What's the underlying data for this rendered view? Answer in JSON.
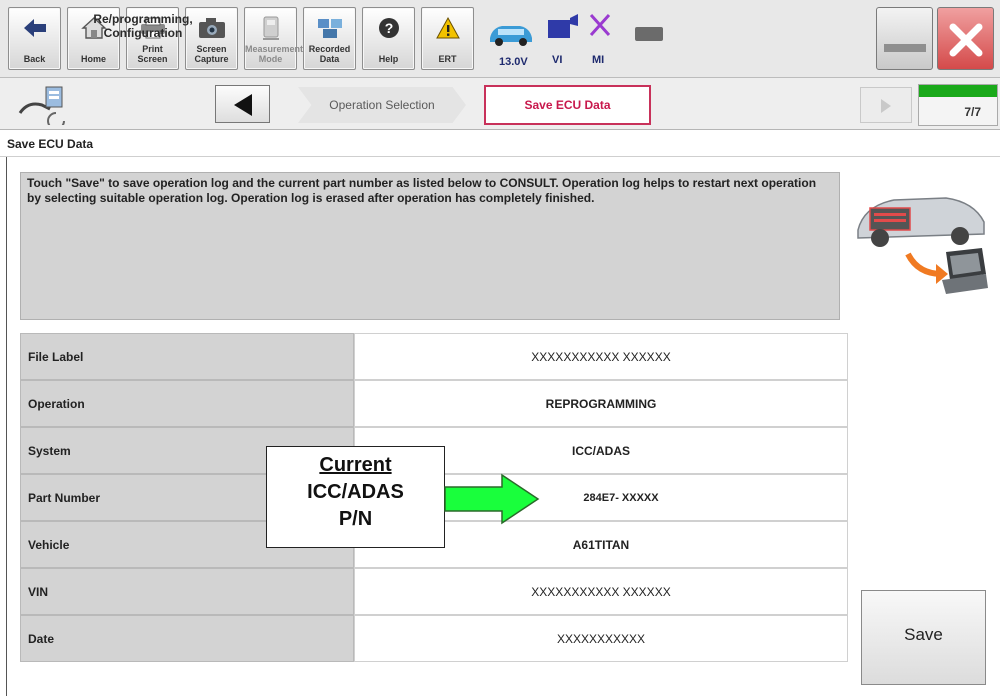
{
  "toolbar": {
    "buttons": [
      {
        "label": "Back",
        "icon": "back-arrow-icon"
      },
      {
        "label": "Home",
        "icon": "home-icon"
      },
      {
        "label": "Print Screen",
        "icon": "printer-icon"
      },
      {
        "label": "Screen Capture",
        "icon": "camera-icon"
      },
      {
        "label": "Measurement Mode",
        "icon": "measurement-icon"
      },
      {
        "label": "Recorded Data",
        "icon": "recorded-data-icon"
      },
      {
        "label": "Help",
        "icon": "help-icon"
      },
      {
        "label": "ERT",
        "icon": "warning-icon"
      }
    ],
    "status": {
      "battery_voltage": "13.0V",
      "vi_label": "VI",
      "mi_label": "MI"
    }
  },
  "breadcrumb": {
    "section_title": "Re/programming, Configuration",
    "steps": [
      "Operation Selection",
      "Save ECU Data"
    ],
    "progress_text": "7/7",
    "progress_fraction": 1.0
  },
  "page": {
    "title": "Save ECU Data",
    "instructions": "Touch \"Save\" to save operation log and the current part number as listed below to CONSULT. Operation log helps to restart next operation by selecting suitable operation log. Operation log is erased after operation has completely finished."
  },
  "table": {
    "rows": [
      {
        "label": "File Label",
        "value": "XXXXXXXXXXX XXXXXX"
      },
      {
        "label": "Operation",
        "value": "REPROGRAMMING"
      },
      {
        "label": "System",
        "value": "ICC/ADAS"
      },
      {
        "label": "Part Number",
        "value": "284E7- XXXXX"
      },
      {
        "label": "Vehicle",
        "value": "A61TITAN"
      },
      {
        "label": "VIN",
        "value": "XXXXXXXXXXX XXXXXX"
      },
      {
        "label": "Date",
        "value": "XXXXXXXXXXX"
      }
    ]
  },
  "actions": {
    "save_label": "Save"
  },
  "callout": {
    "line1": "Current",
    "line2": "ICC/ADAS",
    "line3": "P/N"
  },
  "colors": {
    "accent_red": "#c8184c",
    "progress_green": "#1aa91a",
    "arrow_green": "#19ff3c"
  }
}
